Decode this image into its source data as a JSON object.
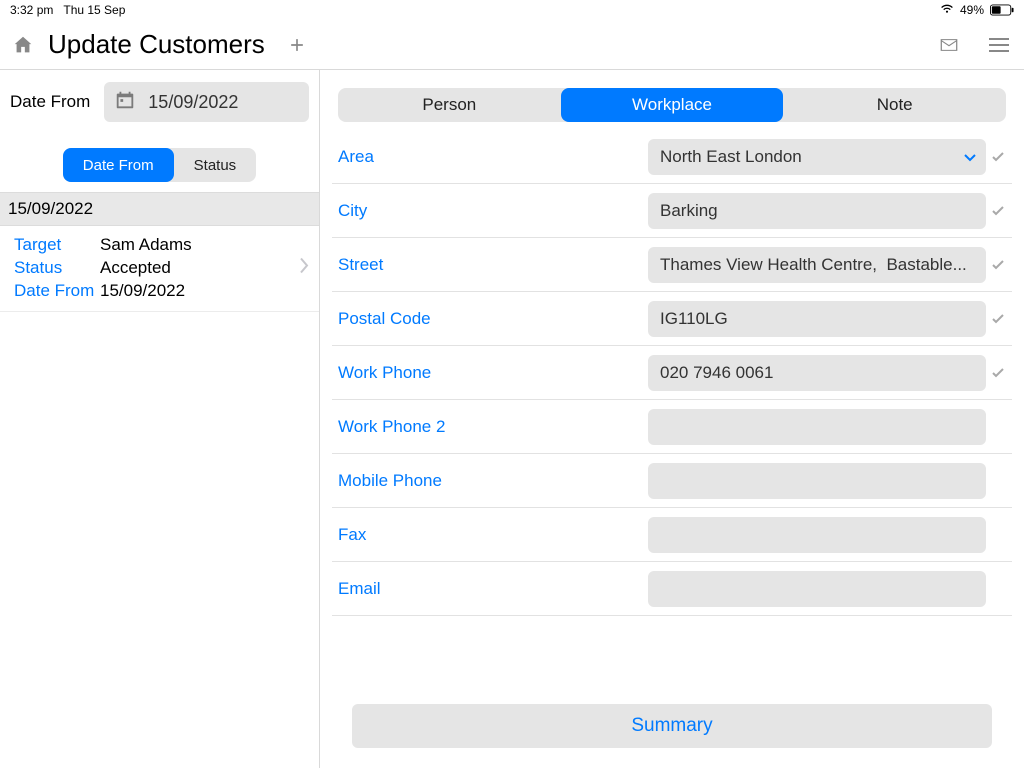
{
  "status": {
    "time": "3:32 pm",
    "date": "Thu 15 Sep",
    "battery_pct": "49%"
  },
  "titlebar": {
    "title": "Update Customers"
  },
  "sidebar": {
    "date_from_label": "Date From",
    "date_from_value": "15/09/2022",
    "seg": {
      "date_from": "Date From",
      "status": "Status"
    },
    "group_header": "15/09/2022",
    "card": {
      "target_label": "Target",
      "target_value": "Sam Adams",
      "status_label": "Status",
      "status_value": "Accepted",
      "datefrom_label": "Date From",
      "datefrom_value": "15/09/2022"
    }
  },
  "tabs": {
    "person": "Person",
    "workplace": "Workplace",
    "note": "Note"
  },
  "form": {
    "area": {
      "label": "Area",
      "value": "North East London"
    },
    "city": {
      "label": "City",
      "value": "Barking"
    },
    "street": {
      "label": "Street",
      "value": "Thames View Health Centre,  Bastable..."
    },
    "postal": {
      "label": "Postal Code",
      "value": "IG110LG"
    },
    "workphone": {
      "label": "Work Phone",
      "value": "020 7946 0061"
    },
    "workphone2": {
      "label": "Work Phone 2",
      "value": ""
    },
    "mobile": {
      "label": "Mobile Phone",
      "value": ""
    },
    "fax": {
      "label": "Fax",
      "value": ""
    },
    "email": {
      "label": "Email",
      "value": ""
    }
  },
  "summary": {
    "label": "Summary"
  }
}
